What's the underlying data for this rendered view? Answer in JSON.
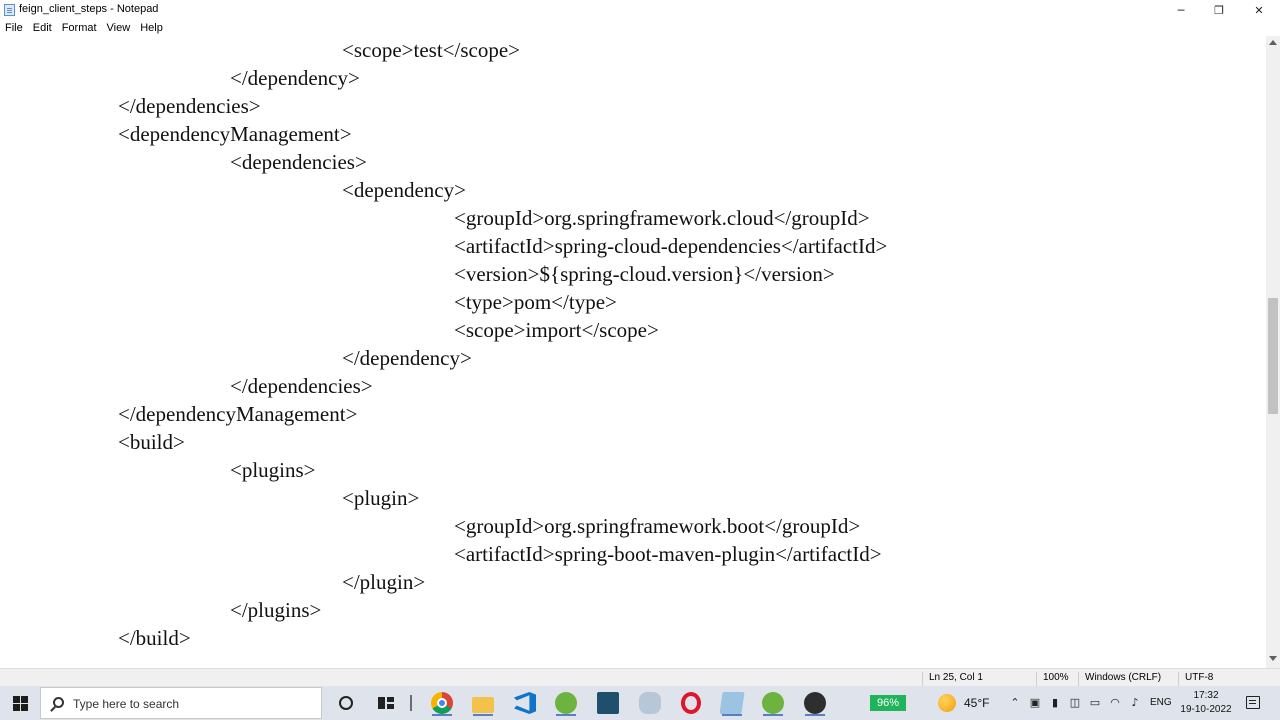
{
  "window": {
    "title": "feign_client_steps - Notepad",
    "controls": {
      "minimize": "─",
      "maximize": "❐",
      "close": "✕"
    }
  },
  "menu": [
    "File",
    "Edit",
    "Format",
    "View",
    "Help"
  ],
  "editor": {
    "lines": [
      {
        "indent": 2,
        "text": "<scope>test</scope>"
      },
      {
        "indent": 1,
        "text": "</dependency>"
      },
      {
        "indent": 0,
        "text": "</dependencies>"
      },
      {
        "indent": 0,
        "text": "<dependencyManagement>"
      },
      {
        "indent": 1,
        "text": "<dependencies>"
      },
      {
        "indent": 2,
        "text": "<dependency>"
      },
      {
        "indent": 3,
        "text": "<groupId>org.springframework.cloud</groupId>"
      },
      {
        "indent": 3,
        "text": "<artifactId>spring-cloud-dependencies</artifactId>"
      },
      {
        "indent": 3,
        "text": "<version>${spring-cloud.version}</version>"
      },
      {
        "indent": 3,
        "text": "<type>pom</type>"
      },
      {
        "indent": 3,
        "text": "<scope>import</scope>"
      },
      {
        "indent": 2,
        "text": "</dependency>"
      },
      {
        "indent": 1,
        "text": "</dependencies>"
      },
      {
        "indent": 0,
        "text": "</dependencyManagement>"
      },
      {
        "indent": 0,
        "text": "<build>"
      },
      {
        "indent": 1,
        "text": "<plugins>"
      },
      {
        "indent": 2,
        "text": "<plugin>"
      },
      {
        "indent": 3,
        "text": "<groupId>org.springframework.boot</groupId>"
      },
      {
        "indent": 3,
        "text": "<artifactId>spring-boot-maven-plugin</artifactId>"
      },
      {
        "indent": 2,
        "text": "</plugin>"
      },
      {
        "indent": 1,
        "text": "</plugins>"
      },
      {
        "indent": 0,
        "text": "</build>"
      }
    ]
  },
  "status": {
    "position": "Ln 25, Col 1",
    "zoom": "100%",
    "line_ending": "Windows (CRLF)",
    "encoding": "UTF-8"
  },
  "taskbar": {
    "search_placeholder": "Type here to search",
    "apps": [
      {
        "name": "chrome",
        "icon": "chrome-icon"
      },
      {
        "name": "file-explorer",
        "icon": "folder-icon"
      },
      {
        "name": "vscode",
        "icon": "vscode-icon"
      },
      {
        "name": "spring-tool-suite",
        "icon": "spring-icon"
      },
      {
        "name": "terminal",
        "icon": "terminal-icon"
      },
      {
        "name": "shell",
        "icon": "shell-icon"
      },
      {
        "name": "opera",
        "icon": "opera-icon"
      },
      {
        "name": "notepad",
        "icon": "notepad-icon"
      },
      {
        "name": "spring-tool-suite-2",
        "icon": "spring-icon"
      },
      {
        "name": "obs",
        "icon": "obs-icon"
      }
    ],
    "battery": "96%",
    "temperature": "45°F",
    "language": "ENG",
    "time": "17:32",
    "date": "19-10-2022"
  }
}
